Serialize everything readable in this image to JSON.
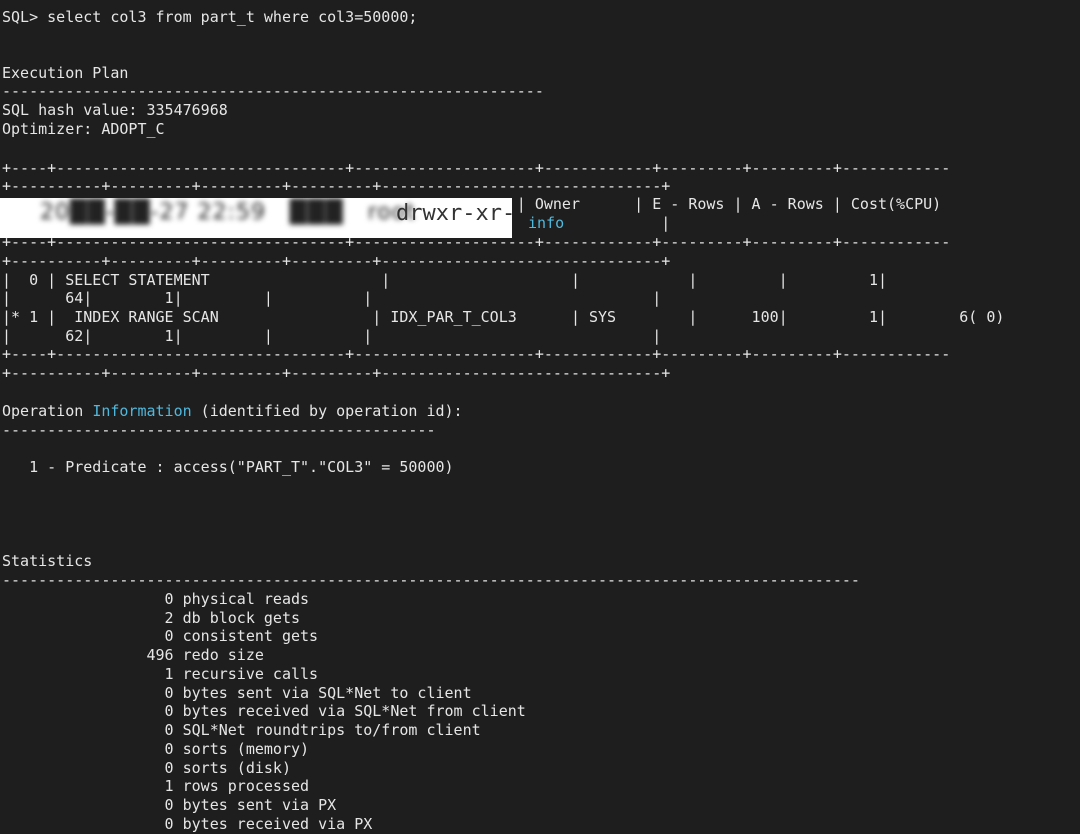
{
  "query_line": "SQL> select col3 from part_t where col3=50000;",
  "plan_title": "Execution Plan",
  "dash_plan": "------------------------------------------------------------",
  "hash_line": "SQL hash value: 335476968",
  "optimizer_line": "Optimizer: ADOPT_C",
  "table_border_a": "+----+--------------------------------+--------------------+------------+---------+---------+------------",
  "table_border_b": "+----------+---------+---------+---------+-------------------------------+",
  "header_line": "                                                         | Owner      | E - Rows | A - Rows | Cost(%CPU)",
  "header_cont": "                                                                         |",
  "overlay": {
    "blurred_text": "20██-██-27 22:59   ███   root",
    "perm_text": "drwxr-xr-x",
    "info_word": "info"
  },
  "row0_a": "|  0 | SELECT STATEMENT                   |                    |            |         |         1|",
  "row0_b": "|      64|        1|         |          |                               |",
  "row1_a_pre": "|* 1 |  INDEX RANGE SCAN                 | IDX_PAR_T_COL3      | SYS        |      100|         1|        6( 0)",
  "row1_b": "|      62|        1|         |          |                               |",
  "op_info_pre": "Operation ",
  "op_info_word": "Information",
  "op_info_post": " (identified by operation id):",
  "dash_op": "------------------------------------------------",
  "predicate_line": "   1 - Predicate : access(\"PART_T\".\"COL3\" = 50000)",
  "stats_title": "Statistics",
  "dash_stats": "-----------------------------------------------------------------------------------------------",
  "stats": [
    "                  0 physical reads",
    "                  2 db block gets",
    "                  0 consistent gets",
    "                496 redo size",
    "                  1 recursive calls",
    "                  0 bytes sent via SQL*Net to client",
    "                  0 bytes received via SQL*Net from client",
    "                  0 SQL*Net roundtrips to/from client",
    "                  0 sorts (memory)",
    "                  0 sorts (disk)",
    "                  1 rows processed",
    "                  0 bytes sent via PX",
    "                  0 bytes received via PX"
  ],
  "colors": {
    "background": "#1e1e1e",
    "text": "#e6e6e6",
    "highlight": "#4fb8dd"
  }
}
